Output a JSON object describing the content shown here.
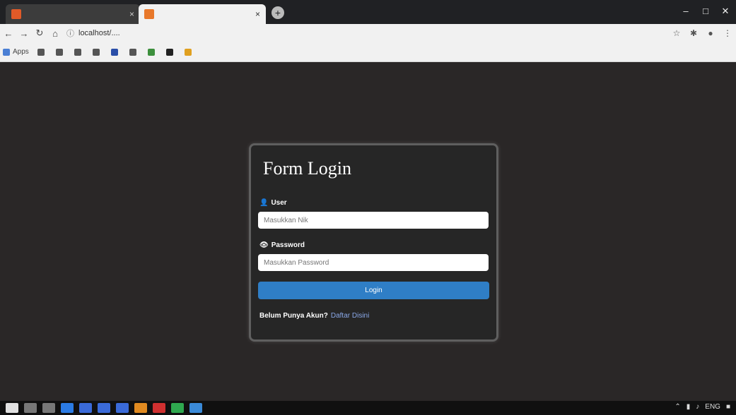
{
  "browser": {
    "tabs": [
      {
        "title": "",
        "favicon_color": "#e05a28"
      },
      {
        "title": "",
        "favicon_color": "#e8782a"
      }
    ],
    "new_tab_label": "+",
    "window": {
      "minimize": "–",
      "maximize": "□",
      "close": "✕"
    },
    "nav": {
      "back": "←",
      "forward": "→",
      "reload": "↻",
      "home": "⌂"
    },
    "url": "localhost/....",
    "toolbar_icons": {
      "bookmark": "☆",
      "extensions": "✱",
      "profile": "●",
      "menu": "⋮"
    },
    "bookmarks": [
      {
        "label": "Apps",
        "color": "#4a7fd4"
      },
      {
        "label": "",
        "color": "#555555"
      },
      {
        "label": "",
        "color": "#555555"
      },
      {
        "label": "",
        "color": "#555555"
      },
      {
        "label": "",
        "color": "#555555"
      },
      {
        "label": "",
        "color": "#2a4ea8"
      },
      {
        "label": "",
        "color": "#555555"
      },
      {
        "label": "",
        "color": "#3c8f3c"
      },
      {
        "label": "",
        "color": "#222222"
      },
      {
        "label": "",
        "color": "#e0a020"
      }
    ]
  },
  "login": {
    "title": "Form Login",
    "user_label": "User",
    "user_placeholder": "Masukkan Nik",
    "password_label": "Password",
    "password_placeholder": "Masukkan Password",
    "submit_label": "Login",
    "register_text": "Belum Punya Akun?",
    "register_link": "Daftar Disini"
  },
  "taskbar": {
    "apps": [
      "#e0e0e0",
      "#e0e0e0",
      "#e0e0e0",
      "#2b7be4",
      "#3a6ad8",
      "#3a6ad8",
      "#3a6ad8",
      "#e08a20",
      "#d03030",
      "#2fa84f",
      "#3a8ad8"
    ],
    "tray": [
      "⌃",
      "▮",
      "♪",
      "ENG",
      "■"
    ]
  },
  "colors": {
    "accent": "#2f7ec6",
    "page_bg": "#2a2727",
    "card_bg": "#262626"
  }
}
